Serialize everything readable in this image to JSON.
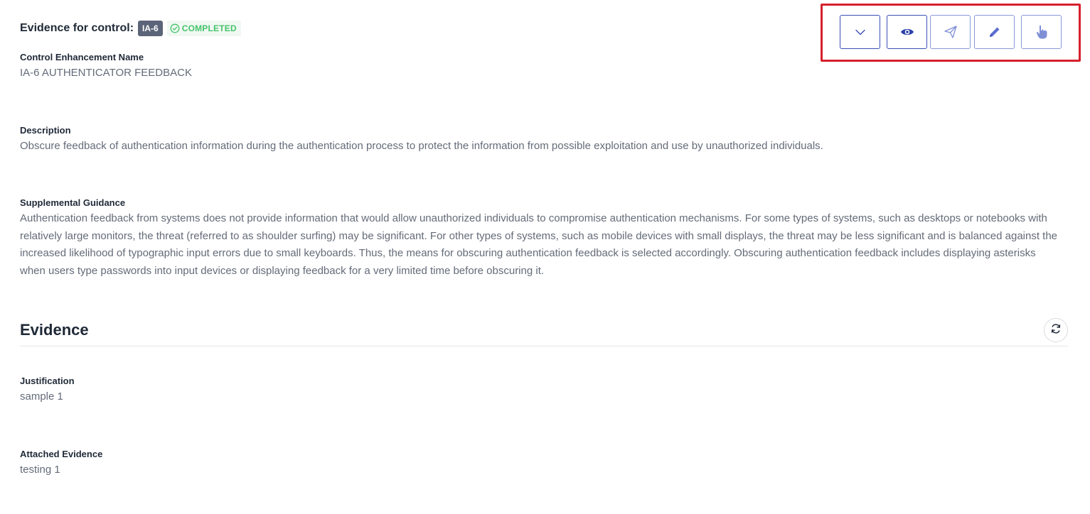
{
  "header": {
    "title": "Evidence for control:",
    "control_id": "IA-6",
    "status": "COMPLETED"
  },
  "toolbar": {
    "buttons": [
      {
        "icon": "chevron-down-icon"
      },
      {
        "icon": "eye-icon"
      },
      {
        "icon": "send-icon"
      },
      {
        "icon": "pencil-icon"
      },
      {
        "icon": "hand-pointer-icon"
      }
    ],
    "highlight_color": "#d6202d",
    "accent_color": "#3a4fb5"
  },
  "control": {
    "enhancement_name_label": "Control Enhancement Name",
    "enhancement_name": "IA-6 AUTHENTICATOR FEEDBACK",
    "description_label": "Description",
    "description": "Obscure feedback of authentication information during the authentication process to protect the information from possible exploitation and use by unauthorized individuals.",
    "guidance_label": "Supplemental Guidance",
    "guidance": "Authentication feedback from systems does not provide information that would allow unauthorized individuals to compromise authentication mechanisms. For some types of systems, such as desktops or notebooks with relatively large monitors, the threat (referred to as shoulder surfing) may be significant. For other types of systems, such as mobile devices with small displays, the threat may be less significant and is balanced against the increased likelihood of typographic input errors due to small keyboards. Thus, the means for obscuring authentication feedback is selected accordingly. Obscuring authentication feedback includes displaying asterisks when users type passwords into input devices or displaying feedback for a very limited time before obscuring it."
  },
  "evidence": {
    "title": "Evidence",
    "refresh_icon": "refresh-icon",
    "justification_label": "Justification",
    "justification": "sample 1",
    "attached_label": "Attached Evidence",
    "attached": "testing 1"
  }
}
